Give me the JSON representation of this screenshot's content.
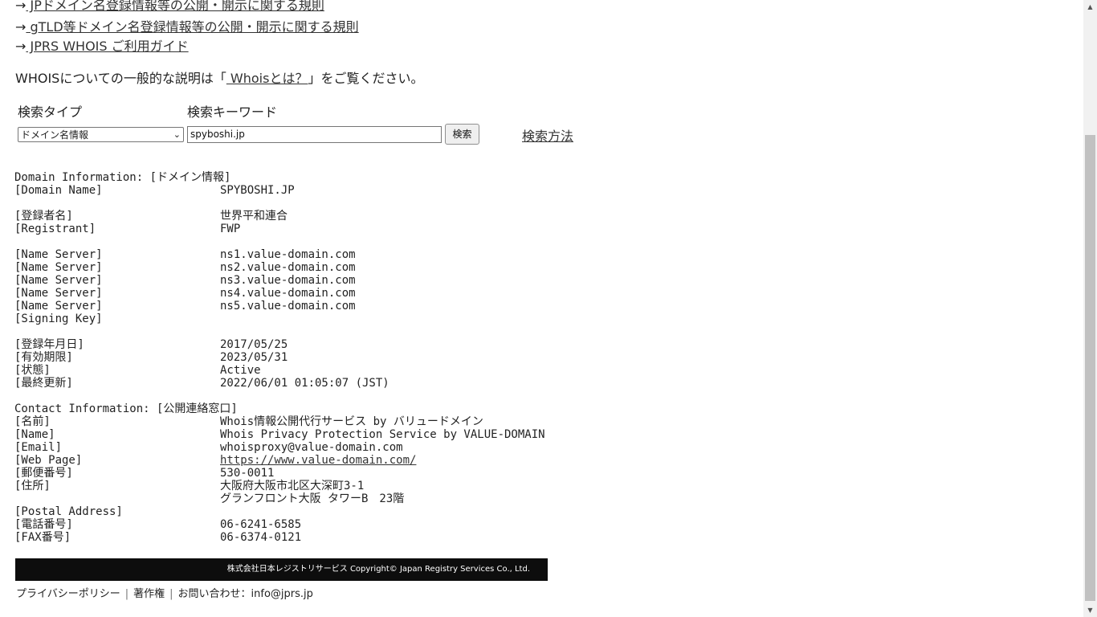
{
  "top_links": [
    {
      "arrow": "→",
      "label": " JPドメイン名登録情報等の公開・開示に関する規則"
    },
    {
      "arrow": "→",
      "label": " gTLD等ドメイン名登録情報等の公開・開示に関する規則"
    },
    {
      "arrow": "→",
      "label": " JPRS WHOIS ご利用ガイド"
    }
  ],
  "intro": {
    "before": "WHOISについての一般的な説明は「",
    "link": " Whoisとは？",
    "after": "」をご覧ください。"
  },
  "search": {
    "type_label": "検索タイプ",
    "keyword_label": "検索キーワード",
    "type_value": "ドメイン名情報",
    "keyword_value": "spyboshi.jp",
    "button_label": "検索",
    "howto_label": "検索方法"
  },
  "whois": {
    "header1": "Domain Information: [ドメイン情報]",
    "domain_name_key": "[Domain Name]",
    "domain_name": "SPYBOSHI.JP",
    "registrant_jp_key": "[登録者名]",
    "registrant_jp": "世界平和連合",
    "registrant_key": "[Registrant]",
    "registrant": "FWP",
    "name_server_key": "[Name Server]",
    "name_servers": [
      "ns1.value-domain.com",
      "ns2.value-domain.com",
      "ns3.value-domain.com",
      "ns4.value-domain.com",
      "ns5.value-domain.com"
    ],
    "signing_key_key": "[Signing Key]",
    "created_key": "[登録年月日]",
    "created": "2017/05/25",
    "expires_key": "[有効期限]",
    "expires": "2023/05/31",
    "status_key": "[状態]",
    "status": "Active",
    "updated_key": "[最終更新]",
    "updated": "2022/06/01 01:05:07 (JST)",
    "header2": "Contact Information: [公開連絡窓口]",
    "name_jp_key": "[名前]",
    "name_jp": "Whois情報公開代行サービス by バリュードメイン",
    "name_key": "[Name]",
    "name": "Whois Privacy Protection Service by VALUE-DOMAIN",
    "email_key": "[Email]",
    "email": "whoisproxy@value-domain.com",
    "webpage_key": "[Web Page]",
    "webpage": "https://www.value-domain.com/",
    "postal_code_key": "[郵便番号]",
    "postal_code": "530-0011",
    "address_key": "[住所]",
    "address_line1": "大阪府大阪市北区大深町3-1",
    "address_line2": "グランフロント大阪 タワーB　23階",
    "postal_address_key": "[Postal Address]",
    "phone_key": "[電話番号]",
    "phone": "06-6241-6585",
    "fax_key": "[FAX番号]",
    "fax": "06-6374-0121"
  },
  "footer": {
    "copyright": "株式会社日本レジストリサービス Copyright© Japan Registry Services Co., Ltd.",
    "privacy": "プライバシーポリシー",
    "copyright_link": "著作権",
    "contact": "お問い合わせ：info@jprs.jp",
    "separator": "|"
  },
  "icons": {
    "select_chevron": "chevron-down-icon",
    "scroll_up": "scroll-up-arrow-icon",
    "scroll_down": "scroll-down-arrow-icon"
  }
}
